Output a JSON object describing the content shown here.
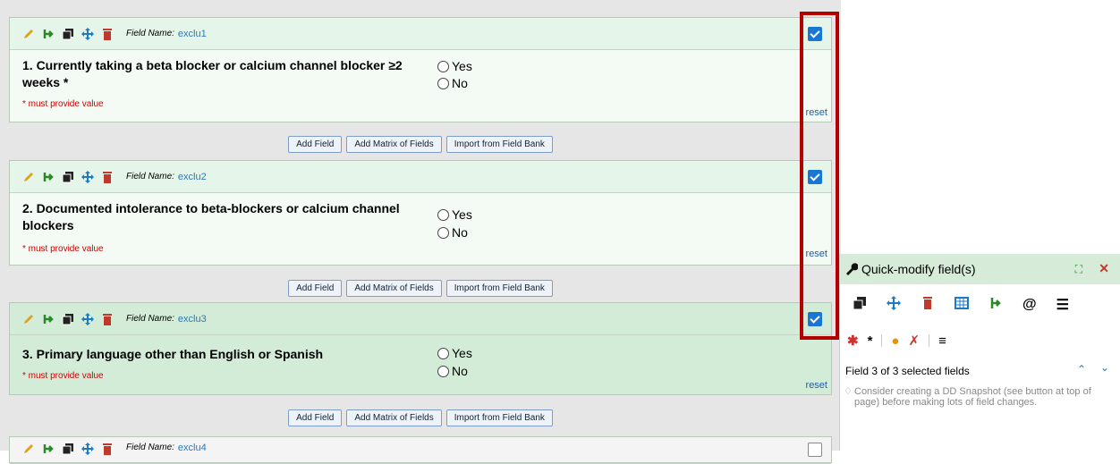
{
  "fields": [
    {
      "field_name_label": "Field Name:",
      "field_name": "exclu1",
      "question": "1. Currently taking a beta blocker or calcium channel blocker ≥2 weeks *",
      "options": [
        "Yes",
        "No"
      ],
      "required_text": "* must provide value",
      "reset_label": "reset",
      "checked": true
    },
    {
      "field_name_label": "Field Name:",
      "field_name": "exclu2",
      "question": "2. Documented intolerance to beta-blockers or calcium channel blockers",
      "options": [
        "Yes",
        "No"
      ],
      "required_text": "* must provide value",
      "reset_label": "reset",
      "checked": true
    },
    {
      "field_name_label": "Field Name:",
      "field_name": "exclu3",
      "question": "3. Primary language other than English or Spanish",
      "options": [
        "Yes",
        "No"
      ],
      "required_text": "* must provide value",
      "reset_label": "reset",
      "checked": true
    },
    {
      "field_name_label": "Field Name:",
      "field_name": "exclu4",
      "checked": false
    }
  ],
  "add_buttons": {
    "add_field": "Add Field",
    "add_matrix": "Add Matrix of Fields",
    "import_bank": "Import from Field Bank"
  },
  "quick_modify": {
    "title": "Quick-modify field(s)",
    "status": "Field 3 of 3 selected fields",
    "tip": "Consider creating a DD Snapshot (see button at top of page) before making lots of field changes.",
    "tools": [
      "copy-icon",
      "move-icon",
      "delete-icon",
      "matrix-icon",
      "branching-icon",
      "at-icon",
      "list-icon"
    ],
    "tools2": [
      "required-icon",
      "not-required-icon",
      "identifier-icon",
      "not-identifier-icon",
      "align-icon"
    ]
  },
  "colors": {
    "highlight_border": "#b40000",
    "checkbox": "#1976d2",
    "field_bg_selected": "#d3ecd8",
    "panel_header": "#d6ecd9"
  }
}
